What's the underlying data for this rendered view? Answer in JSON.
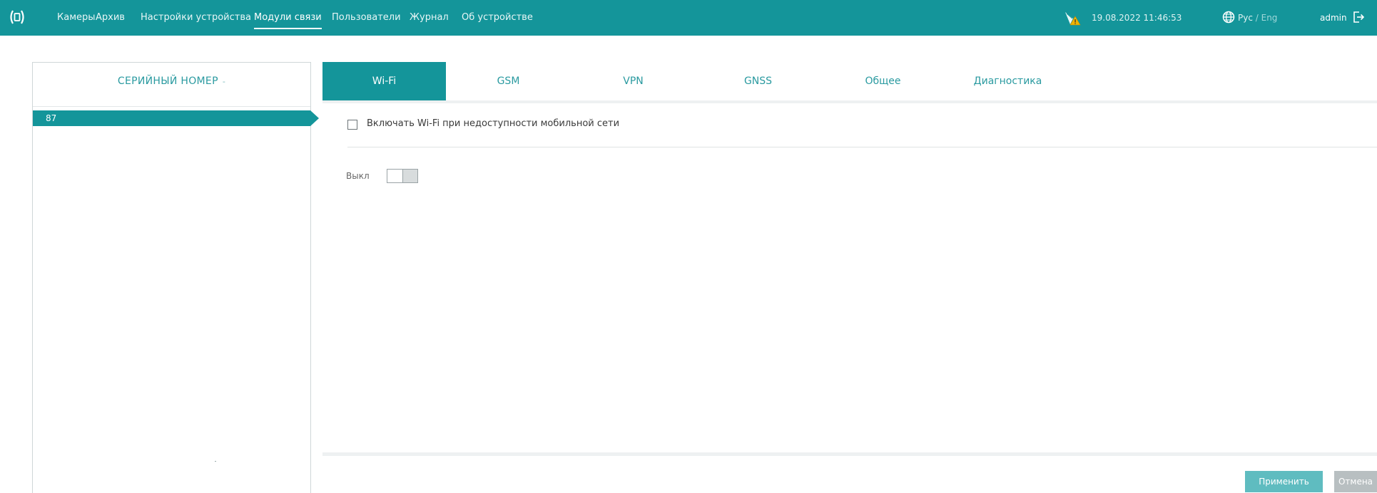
{
  "nav": {
    "items": [
      {
        "label": "Камеры"
      },
      {
        "label": "Архив"
      },
      {
        "label": "Настройки устройства"
      },
      {
        "label": "Модули связи"
      },
      {
        "label": "Пользователи"
      },
      {
        "label": "Журнал"
      },
      {
        "label": "Об устройстве"
      }
    ],
    "active_index": 3
  },
  "header": {
    "datetime": "19.08.2022 11:46:53",
    "lang_ru": "Рус",
    "lang_sep": " / ",
    "lang_en": "Eng",
    "user": "admin",
    "icons": [
      "logo-icon",
      "warning-icon",
      "globe-icon",
      "logout-icon"
    ]
  },
  "left_panel": {
    "header": "СЕРИЙНЫЙ НОМЕР",
    "sort_indicator": "-",
    "rows": [
      {
        "label": "87",
        "selected": true
      }
    ]
  },
  "tabs": [
    {
      "label": "Wi-Fi",
      "active": true
    },
    {
      "label": "GSM",
      "active": false
    },
    {
      "label": "VPN",
      "active": false
    },
    {
      "label": "GNSS",
      "active": false
    },
    {
      "label": "Общее",
      "active": false
    },
    {
      "label": "Диагностика",
      "active": false
    }
  ],
  "wifi": {
    "fallback_checkbox_label": "Включать Wi-Fi при недоступности мобильной сети",
    "fallback_checked": false,
    "toggle_label": "Выкл",
    "toggle_on": false
  },
  "buttons": {
    "apply": "Применить",
    "cancel": "Отмена"
  },
  "colors": {
    "accent": "#14959a",
    "apply_button": "#5fbcc0",
    "cancel_button": "#b8bfc1"
  }
}
